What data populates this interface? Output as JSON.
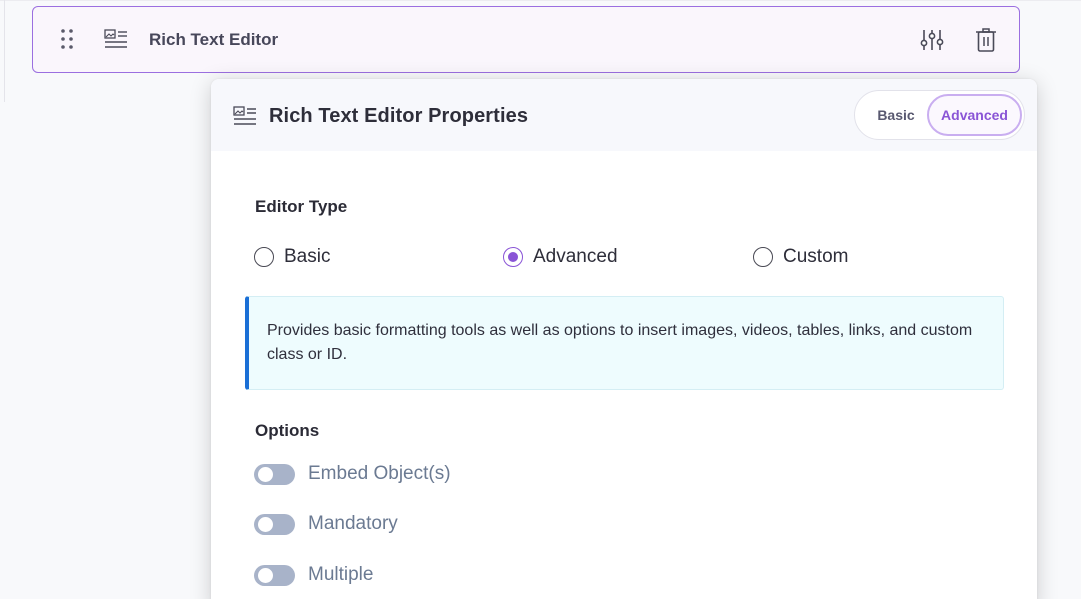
{
  "field": {
    "label": "Rich Text Editor",
    "icons": {
      "drag": "drag-handle-icon",
      "type": "rich-text-editor-icon",
      "settings": "sliders-icon",
      "delete": "trash-icon"
    }
  },
  "panel": {
    "title": "Rich Text Editor Properties",
    "mode_switch": {
      "basic": "Basic",
      "advanced": "Advanced",
      "selected": "Advanced"
    },
    "editor_type": {
      "heading": "Editor Type",
      "options": [
        {
          "label": "Basic",
          "checked": false
        },
        {
          "label": "Advanced",
          "checked": true
        },
        {
          "label": "Custom",
          "checked": false
        }
      ],
      "description": "Provides basic formatting tools as well as options to insert images, videos, tables, links, and custom class or ID."
    },
    "options": {
      "heading": "Options",
      "toggles": [
        {
          "label": "Embed Object(s)",
          "on": false
        },
        {
          "label": "Mandatory",
          "on": false
        },
        {
          "label": "Multiple",
          "on": false
        }
      ]
    }
  },
  "colors": {
    "accent": "#8a55d6",
    "info_border": "#1a6fd6",
    "info_bg": "#eefcfe",
    "toggle_off": "#a8b3c9"
  }
}
